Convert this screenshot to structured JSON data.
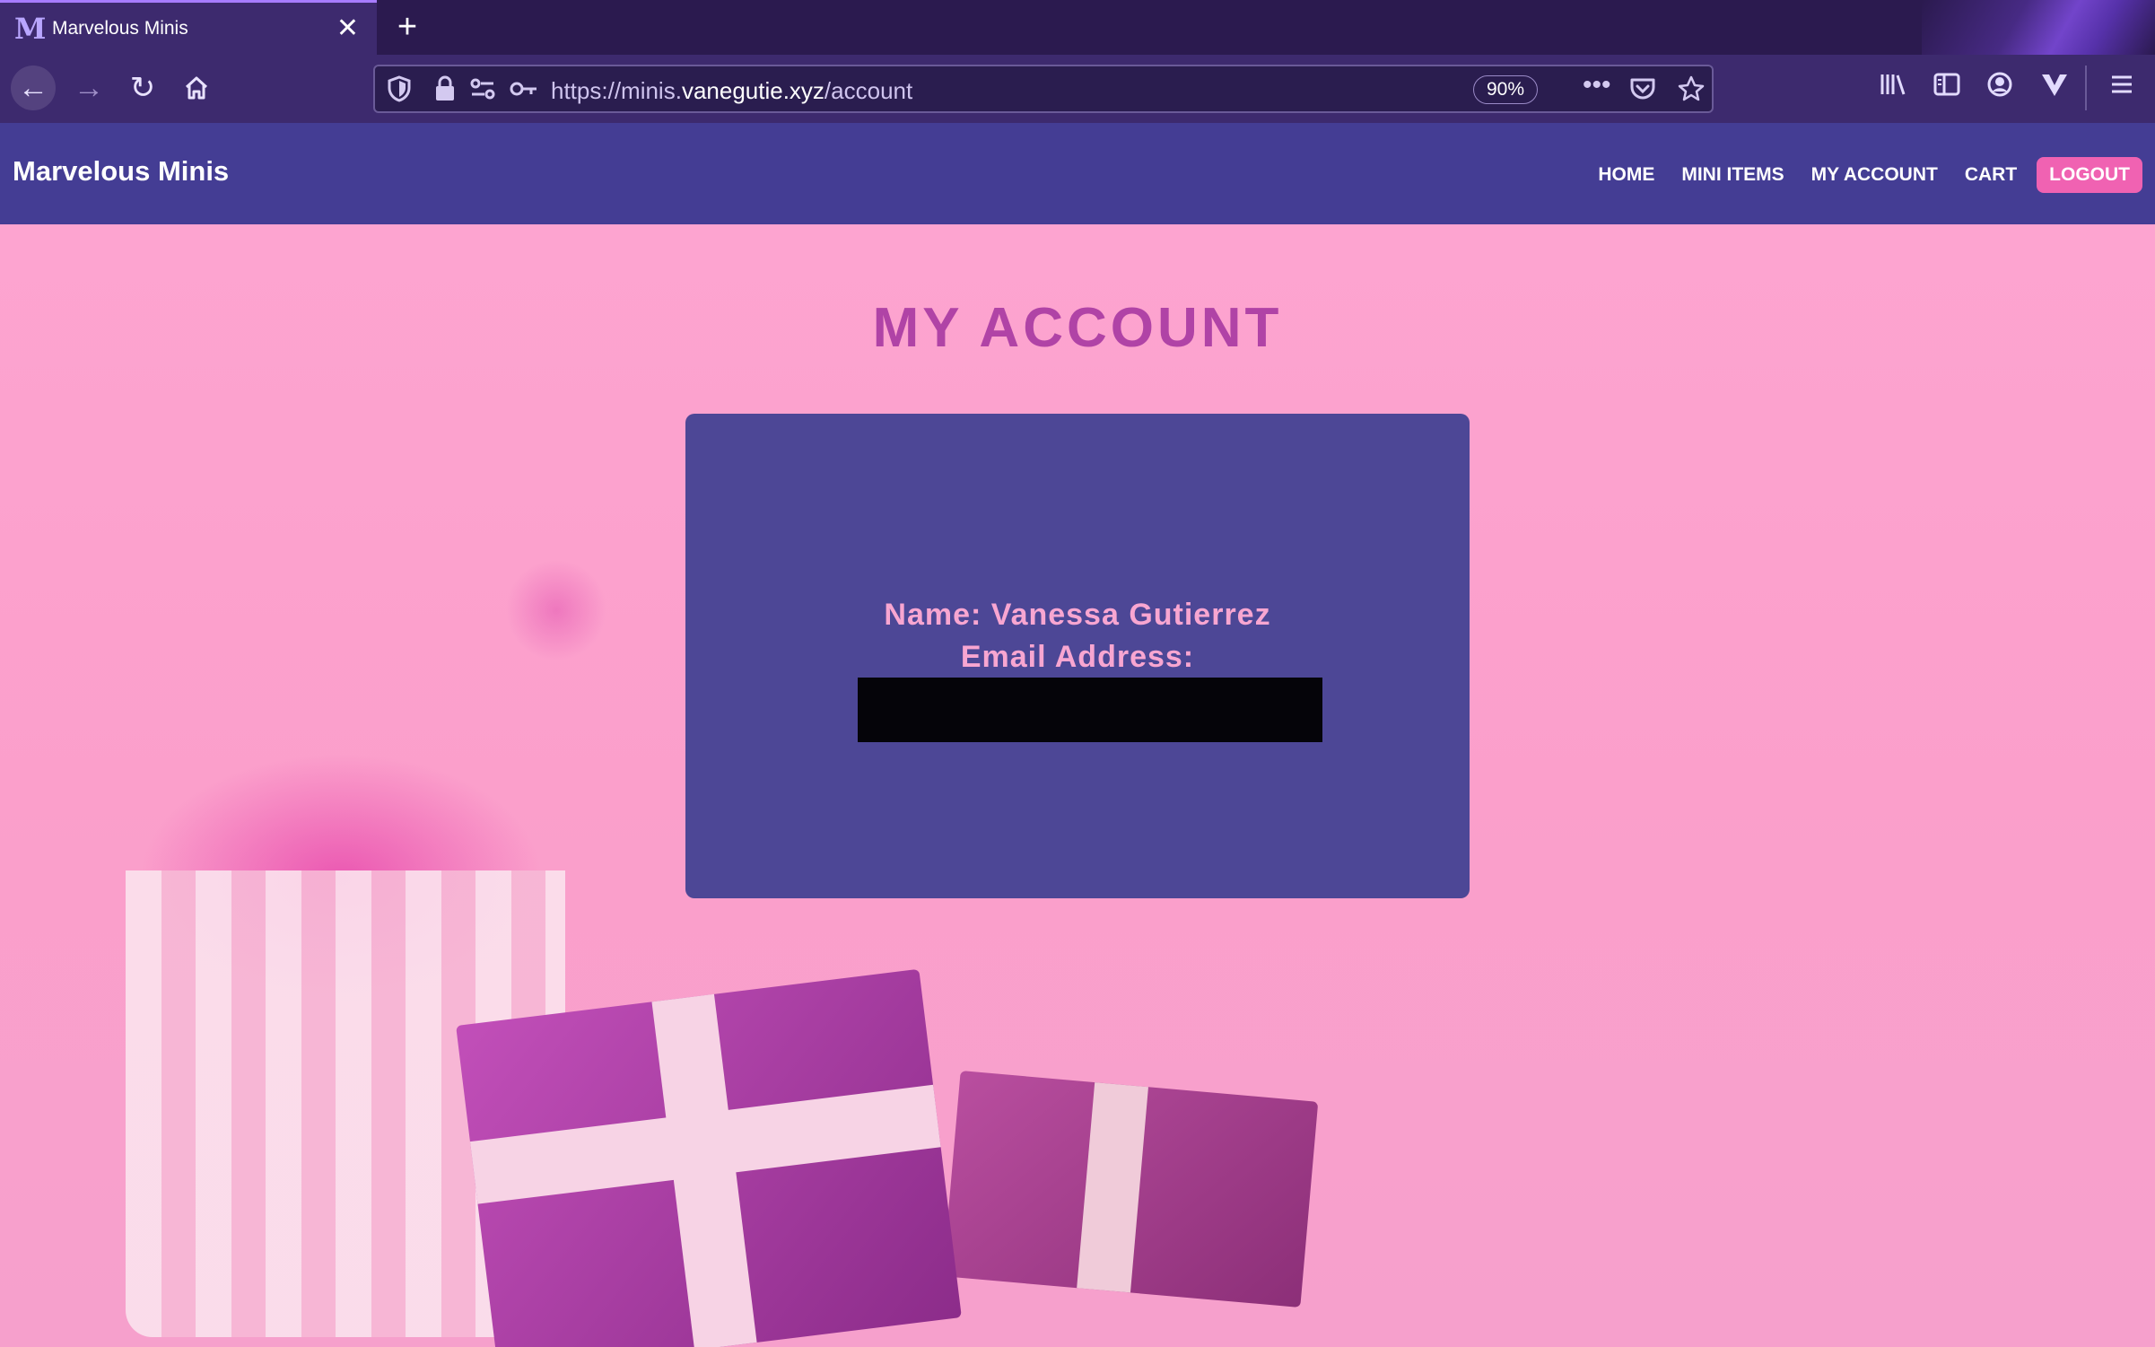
{
  "browser": {
    "tab_title": "Marvelous Minis",
    "favicon_letter": "M",
    "tab_close": "✕",
    "new_tab": "+",
    "url_scheme": "https://minis.",
    "url_host": "vanegutie.xyz",
    "url_path": "/account",
    "zoom": "90%",
    "icons": [
      "back-arrow-icon",
      "forward-arrow-icon",
      "reload-icon",
      "home-icon",
      "shield-icon",
      "lock-icon",
      "permissions-icon",
      "key-icon",
      "more-icon",
      "pocket-icon",
      "star-icon",
      "library-icon",
      "sidebar-icon",
      "account-icon",
      "extension-icon",
      "menu-icon"
    ]
  },
  "site": {
    "brand": "Marvelous Minis",
    "nav": {
      "home": "HOME",
      "mini_items": "MINI ITEMS",
      "my_account": "MY ACCOUNT",
      "cart": "CART",
      "logout": "LOGOUT"
    },
    "page_title": "MY ACCOUNT",
    "account": {
      "name_line": "Name: Vanessa Gutierrez",
      "email_label": "Email Address:",
      "email_value": ""
    }
  },
  "colors": {
    "header_bg": "#443d94",
    "card_bg": "#4d4796",
    "title": "#b043a6",
    "card_text": "#f8a6d1",
    "logout_bg": "#f062b2",
    "page_bg": "#f7a3cd",
    "browser_chrome": "#3d2a6e"
  }
}
